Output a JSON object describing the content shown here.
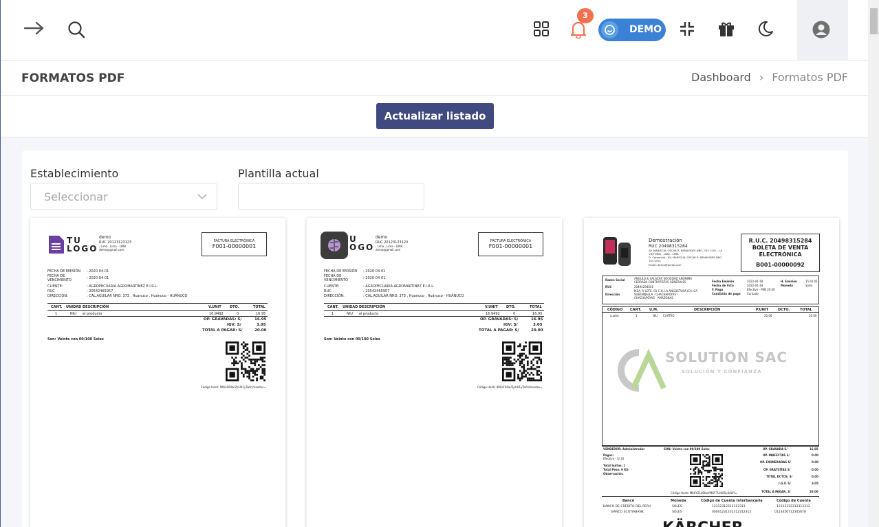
{
  "topbar": {
    "notifications_count": "3",
    "demo_label": "DEMO",
    "icons": [
      "arrow-right-icon",
      "search-icon",
      "apps-grid-icon",
      "bell-icon",
      "collapse-icon",
      "gift-icon",
      "moon-icon",
      "user-circle-icon"
    ]
  },
  "titlebar": {
    "title": "FORMATOS PDF",
    "breadcrumb_home": "Dashboard",
    "breadcrumb_sep": "›",
    "breadcrumb_current": "Formatos PDF"
  },
  "actions": {
    "update_label": "Actualizar listado"
  },
  "form": {
    "establecimiento_label": "Establecimiento",
    "establecimiento_placeholder": "Seleccionar",
    "plantilla_label": "Plantilla actual",
    "plantilla_value": ""
  },
  "templates": [
    {
      "company": "demo",
      "logo_line1": "TU",
      "logo_line2": "LOGO",
      "ruc": "RUC 20123123123",
      "address": ", Lima , Lima - LIMA",
      "email": "demo@gmail.com",
      "doc_type": "FACTURA ELECTRÓNICA",
      "doc_number": "F001-00000001",
      "fecha_emision_label": "FECHA DE EMISIÓN",
      "fecha_emision": ": 2020-04-01",
      "fecha_venc_label": "FECHA DE VENCIMIENTO",
      "fecha_venc": ": 2020-04-01",
      "cliente_label": "CLIENTE:",
      "cliente": ": AGROPECUARIA AGROMARTINEZ E.I.R.L.",
      "ruc_label": "RUC",
      "ruc_cliente": ": 20542465957",
      "direccion_label": "DIRECCIÓN:",
      "direccion": ": CAL.AGUILAR NRO. 373 , Huanuco , Huánuco - HUÁNUCO",
      "cols": [
        "CANT.",
        "UNIDAD DESCRIPCIÓN",
        "V.UNIT",
        "DTO.",
        "TOTAL"
      ],
      "row": [
        "1",
        "NIU",
        "el producto",
        "16.9492",
        "0",
        "16.95"
      ],
      "totals": [
        [
          "OP. GRAVADAS: S/",
          "16.95"
        ],
        [
          "IGV: S/",
          "3.05"
        ],
        [
          "TOTAL A PAGAR: S/",
          "20.00"
        ]
      ],
      "son": "Son: Veinte con 00/100 Soles",
      "hash": "Código Hash: 9M/eF60w/ZpU01yTwfc/maxdev="
    },
    {
      "company": "demo",
      "logo_line1": "U",
      "logo_line2": "OGO",
      "ruc": "RUC 20123123123",
      "address": ", Lima , Lima - LIMA",
      "email": "demo@gmail.com",
      "doc_type": "FACTURA ELECTRÓNICA",
      "doc_number": "F001-00000001",
      "fecha_emision_label": "FECHA DE EMISIÓN",
      "fecha_emision": ": 2020-04-01",
      "fecha_venc_label": "FECHA DE VENCIMIENTO",
      "fecha_venc": ": 2020-04-01",
      "cliente_label": "CLIENTE:",
      "cliente": ": AGROPECUARIA AGROMARTINEZ E.I.R.L.",
      "ruc_label": "RUC",
      "ruc_cliente": ": 20542465957",
      "direccion_label": "DIRECCIÓN:",
      "direccion": ": CAL.AGUILAR NRO. 373 , Huanuco , Huánuco - HUÁNUCO",
      "cols": [
        "CANT.",
        "UNIDAD DESCRIPCIÓN",
        "V.UNIT",
        "DTO.",
        "TOTAL"
      ],
      "row": [
        "1",
        "NIU",
        "el producto",
        "16.9492",
        "0",
        "16.95"
      ],
      "totals": [
        [
          "OP. GRAVADAS: S/",
          "16.95"
        ],
        [
          "IGV: S/",
          "3.05"
        ],
        [
          "TOTAL A PAGAR: S/",
          "20.00"
        ]
      ],
      "son": "Son: Veinte con 00/100 Soles",
      "hash": "Código Hash: 9M/eF60w/ZpU01yTwfc/maxdev="
    },
    {
      "company": "Demostración",
      "ruc": "RUC 20498315284",
      "address1": "AV. MARISCAL OSCAR R. BENAVIDES NRO. 703 COO. , LA",
      "address2": "VICTORIA , LIMA - LIMA",
      "address3": "D. Comercial : AV. MARISCAL OSCAR R. BENAVIDES NRO.",
      "address4": "703 COO.",
      "email": "Email: demo@gmail.com",
      "ruc_box": "R.U.C. 20498315284",
      "doc_type1": "BOLETA DE VENTA",
      "doc_type2": "ELECTRÓNICA",
      "doc_number": "B001-00000092",
      "razon_label": "Razón Social",
      "razon1": "ANGULO & SALAZAR SOCIEDAD ANONIMA",
      "razon2": "CERRADA CONTRATISTAS GENERALES",
      "ruc_label": "RUC",
      "ruc_cliente": "20494294641",
      "dir_label": "Dirección",
      "dir1": "MZA. R LOTE. 01 C.H. LA ANGOSTURA (CA ICA",
      "dir2": "SUBTANJALLA - CHACHAPOYAS -",
      "dir3": "CHACHAPOYAS - AMAZONAS",
      "f_emision_label": "Fecha Emisión",
      "f_emision": "2022-01-18",
      "h_emision_label": "H. Emisión",
      "h_emision": "15:01:01",
      "f_vcto_label": "Fecha de Vcto",
      "f_vcto": "2022-01-18",
      "moneda_label": "Moneda",
      "moneda": "Soles",
      "f_pago_label": "F. Pago",
      "f_pago": "Efectivo - PEN 20.00",
      "cond_label": "Condición de pago",
      "cond": "Contado",
      "cols": [
        "CÓDIGO",
        "CANT.",
        "U.M.",
        "DESCRIPCIÓN",
        "P.UNIT",
        "DCTO.",
        "TOTAL"
      ],
      "row": [
        "cuatro",
        "1",
        "NIU",
        "CUATRO",
        "20.00",
        "",
        "20.00"
      ],
      "watermark1": "SOLUTION SAC",
      "watermark2": "SOLUCIÓN Y CONFIANZA",
      "vendedor": "VENDEDOR: Administrador",
      "son": "SON: Veinte con 00/100 Soles",
      "pagos_label": "Pagos:",
      "pagos": "Efectivo - S/ 20",
      "bultos": "Total bultos: 1",
      "peso": "Total Peso: 0 KG",
      "obs": "Observación:",
      "hash": "Código Hash: Mb6YZLU0boVMOF7Ud/0Sv4sWY=",
      "totals": [
        [
          "OP. GRAVADA S/",
          "16.95"
        ],
        [
          "OP. INAFECTAS S/",
          "0.00"
        ],
        [
          "OP. EXONERADAS S/",
          "0.00"
        ],
        [
          "OP. GRATUITAS S/",
          "0.00"
        ],
        [
          "TOTAL DCTOS. S/",
          "0.00"
        ],
        [
          "I.G.V. S/",
          "3.05"
        ],
        [
          "TOTAL A PAGAR. S/",
          "20.00"
        ]
      ],
      "bank_cols": [
        "Banco",
        "Moneda",
        "Código de Cuenta Interbancaria",
        "Código de Cuenta"
      ],
      "banks": [
        [
          "BANCO DE CREDITO DEL PERU",
          "SOLES",
          "12312312312312313",
          "12312312312312313"
        ],
        [
          "BANCO SCOTIABANK",
          "SOLES",
          "00001231232312312312",
          "0123456712345678"
        ]
      ],
      "footer_brand": "KÄRCHER"
    }
  ],
  "colors": {
    "primary": "#404a80",
    "badge": "#f07050",
    "demo_pill": "#3b82d6",
    "logo_purple": "#6b3fa0"
  }
}
